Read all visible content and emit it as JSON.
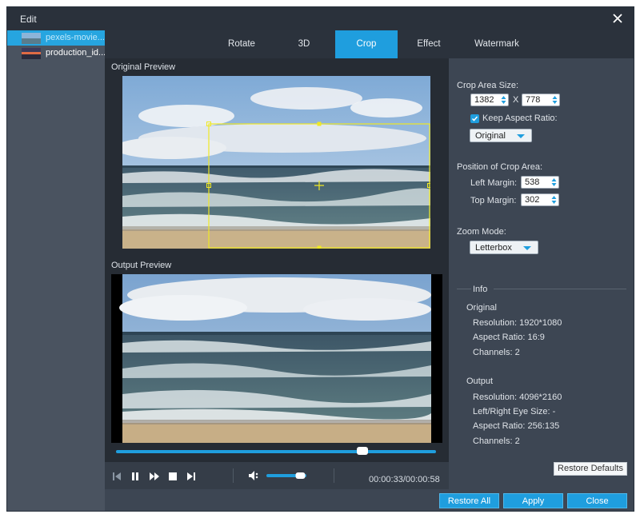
{
  "window": {
    "title": "Edit"
  },
  "files": [
    {
      "name": "pexels-movie...",
      "selected": true
    },
    {
      "name": "production_id...",
      "selected": false
    }
  ],
  "tabs": [
    {
      "label": "Rotate"
    },
    {
      "label": "3D"
    },
    {
      "label": "Crop",
      "active": true
    },
    {
      "label": "Effect"
    },
    {
      "label": "Watermark"
    }
  ],
  "preview": {
    "original_label": "Original Preview",
    "output_label": "Output Preview"
  },
  "crop": {
    "area_size_label": "Crop Area Size:",
    "width": "1382",
    "times": "X",
    "height": "778",
    "keep_aspect_label": "Keep Aspect Ratio:",
    "keep_aspect_checked": true,
    "aspect_select": "Original",
    "position_label": "Position of Crop Area:",
    "left_margin_label": "Left Margin:",
    "left_margin": "538",
    "top_margin_label": "Top Margin:",
    "top_margin": "302",
    "zoom_label": "Zoom Mode:",
    "zoom_select": "Letterbox"
  },
  "info": {
    "heading": "Info",
    "original": {
      "heading": "Original",
      "resolution": "Resolution: 1920*1080",
      "aspect": "Aspect Ratio: 16:9",
      "channels": "Channels: 2"
    },
    "output": {
      "heading": "Output",
      "resolution": "Resolution: 4096*2160",
      "eye_size": "Left/Right Eye Size: -",
      "aspect": "Aspect Ratio: 256:135",
      "channels": "Channels: 2"
    }
  },
  "player": {
    "timecode": "00:00:33/00:00:58",
    "seek_fraction": 0.77,
    "volume_fraction": 0.85
  },
  "buttons": {
    "restore_defaults": "Restore Defaults",
    "restore_all": "Restore All",
    "apply": "Apply",
    "close": "Close"
  },
  "colors": {
    "accent": "#1f9ede",
    "crop_box": "#f0e823"
  }
}
